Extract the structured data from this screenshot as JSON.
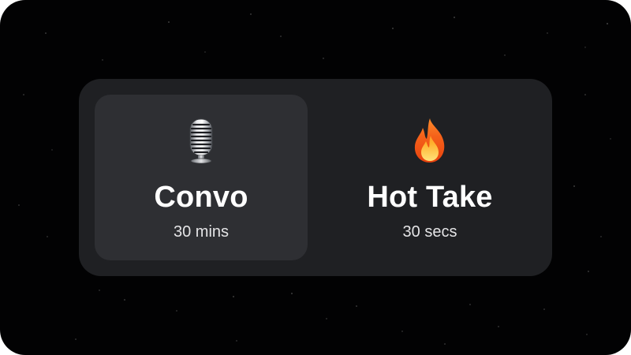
{
  "options": [
    {
      "title": "Convo",
      "duration": "30 mins",
      "icon": "microphone-icon",
      "selected": true
    },
    {
      "title": "Hot Take",
      "duration": "30 secs",
      "icon": "fire-icon",
      "selected": false
    }
  ],
  "colors": {
    "background": "#020203",
    "panel": "#1f2023",
    "selected_option": "#2e2f33",
    "text": "#ffffff"
  }
}
